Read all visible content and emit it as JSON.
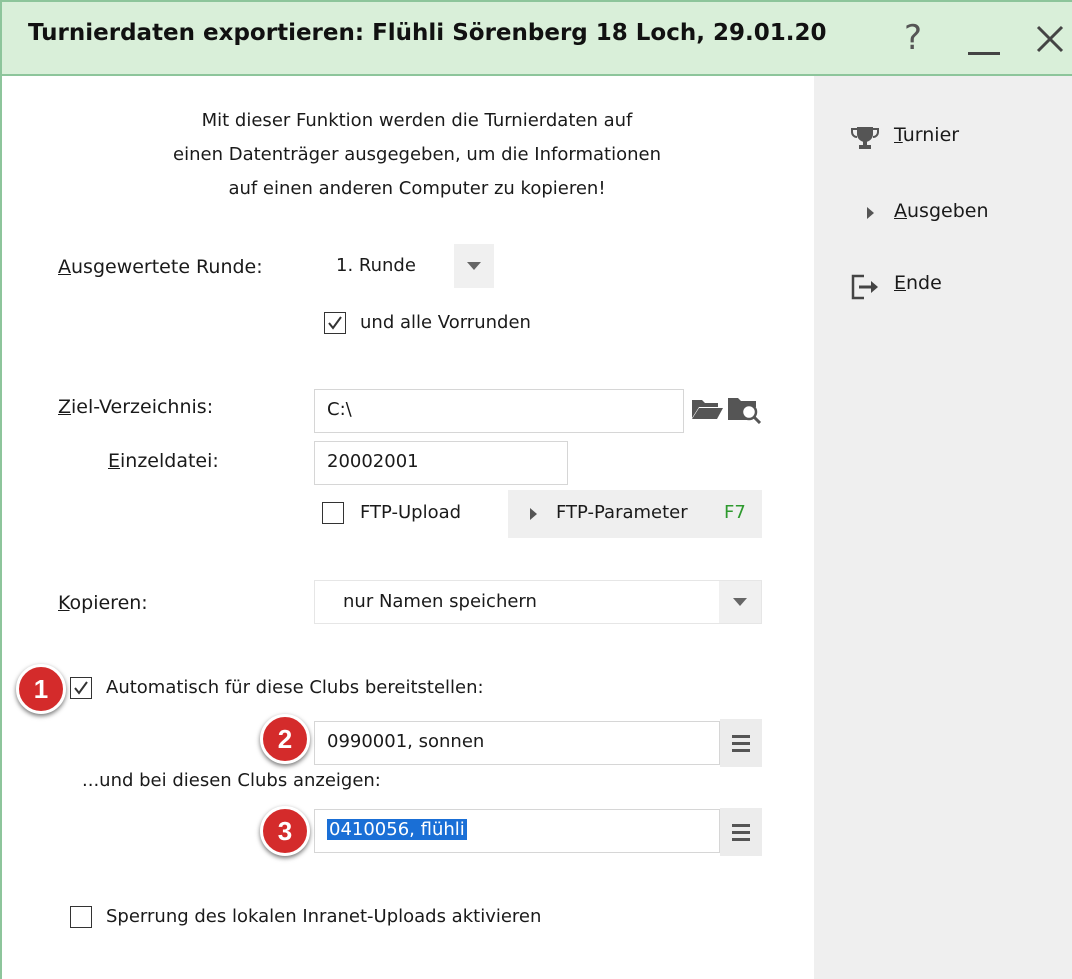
{
  "window": {
    "title": "Turnierdaten exportieren: Flühli Sörenberg 18 Loch, 29.01.20",
    "help": "?",
    "border_color": "#8dc59b",
    "titlebar_bg": "#d9efd9"
  },
  "intro": {
    "line1": "Mit dieser Funktion werden die Turnierdaten auf",
    "line2": "einen Datenträger ausgegeben, um die Informationen",
    "line3": "auf einen anderen Computer zu kopieren!"
  },
  "round": {
    "label_first": "A",
    "label_rest": "usgewertete Runde:",
    "value": "1. Runde"
  },
  "previous_rounds": {
    "label": "und alle Vorrunden",
    "checked": true
  },
  "target_dir": {
    "label_first": "Z",
    "label_rest": "iel-Verzeichnis:",
    "value": "C:\\"
  },
  "single_file": {
    "label_first": "E",
    "label_rest": "inzeldatei:",
    "value": "20002001"
  },
  "ftp_upload": {
    "label": "FTP-Upload",
    "checked": false
  },
  "ftp_params": {
    "label": "FTP-Parameter",
    "key": "F7"
  },
  "copy": {
    "label_first": "K",
    "label_rest": "opieren:",
    "value": "nur Namen speichern"
  },
  "auto_clubs": {
    "label": "Automatisch für diese Clubs bereitstellen:",
    "checked": true,
    "value": "0990001, sonnen"
  },
  "show_clubs": {
    "label": "...und bei diesen Clubs anzeigen:",
    "value": "0410056, flühli"
  },
  "lock_upload": {
    "label": "Sperrung des lokalen Inranet-Uploads aktivieren",
    "checked": false
  },
  "badges": {
    "b1": "1",
    "b2": "2",
    "b3": "3"
  },
  "sidebar": {
    "tournament": {
      "first": "T",
      "rest": "urnier",
      "icon": "trophy-icon"
    },
    "export": {
      "first": "A",
      "rest": "usgeben",
      "icon": "triangle-right-icon"
    },
    "exit": {
      "first": "E",
      "rest": "nde",
      "icon": "exit-icon"
    }
  }
}
